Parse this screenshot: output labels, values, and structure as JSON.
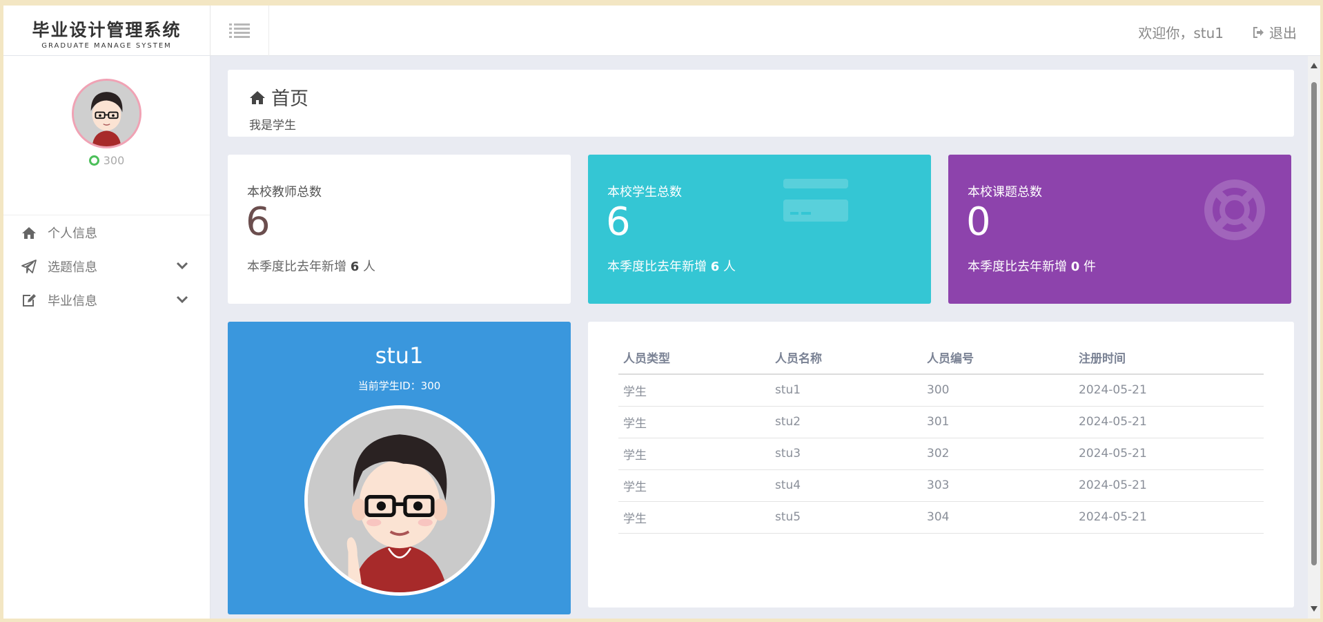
{
  "brand": {
    "title_cn": "毕业设计管理系统",
    "title_en": "GRADUATE MANAGE SYSTEM"
  },
  "header": {
    "welcome": "欢迎你，stu1",
    "logout": "退出"
  },
  "sidebar": {
    "status_value": "300",
    "items": [
      {
        "label": "个人信息",
        "icon": "home-icon"
      },
      {
        "label": "选题信息",
        "icon": "paper-plane-icon"
      },
      {
        "label": "毕业信息",
        "icon": "edit-icon"
      }
    ]
  },
  "page": {
    "title": "首页",
    "subtitle": "我是学生"
  },
  "stats": [
    {
      "label": "本校教师总数",
      "value": "6",
      "foot_pre": "本季度比去年新增",
      "foot_num": "6",
      "foot_unit": "人"
    },
    {
      "label": "本校学生总数",
      "value": "6",
      "foot_pre": "本季度比去年新增",
      "foot_num": "6",
      "foot_unit": "人"
    },
    {
      "label": "本校课题总数",
      "value": "0",
      "foot_pre": "本季度比去年新增",
      "foot_num": "0",
      "foot_unit": "件"
    }
  ],
  "profile": {
    "name": "stu1",
    "id_line": "当前学生ID：300"
  },
  "table": {
    "headers": [
      "人员类型",
      "人员名称",
      "人员编号",
      "注册时间"
    ],
    "rows": [
      [
        "学生",
        "stu1",
        "300",
        "2024-05-21"
      ],
      [
        "学生",
        "stu2",
        "301",
        "2024-05-21"
      ],
      [
        "学生",
        "stu3",
        "302",
        "2024-05-21"
      ],
      [
        "学生",
        "stu4",
        "303",
        "2024-05-21"
      ],
      [
        "学生",
        "stu5",
        "304",
        "2024-05-21"
      ]
    ]
  },
  "colors": {
    "stat_cyan": "#34c6d4",
    "stat_purple": "#8d43ac",
    "profile_blue": "#3a97dd",
    "status_green": "#4cbf5a"
  }
}
